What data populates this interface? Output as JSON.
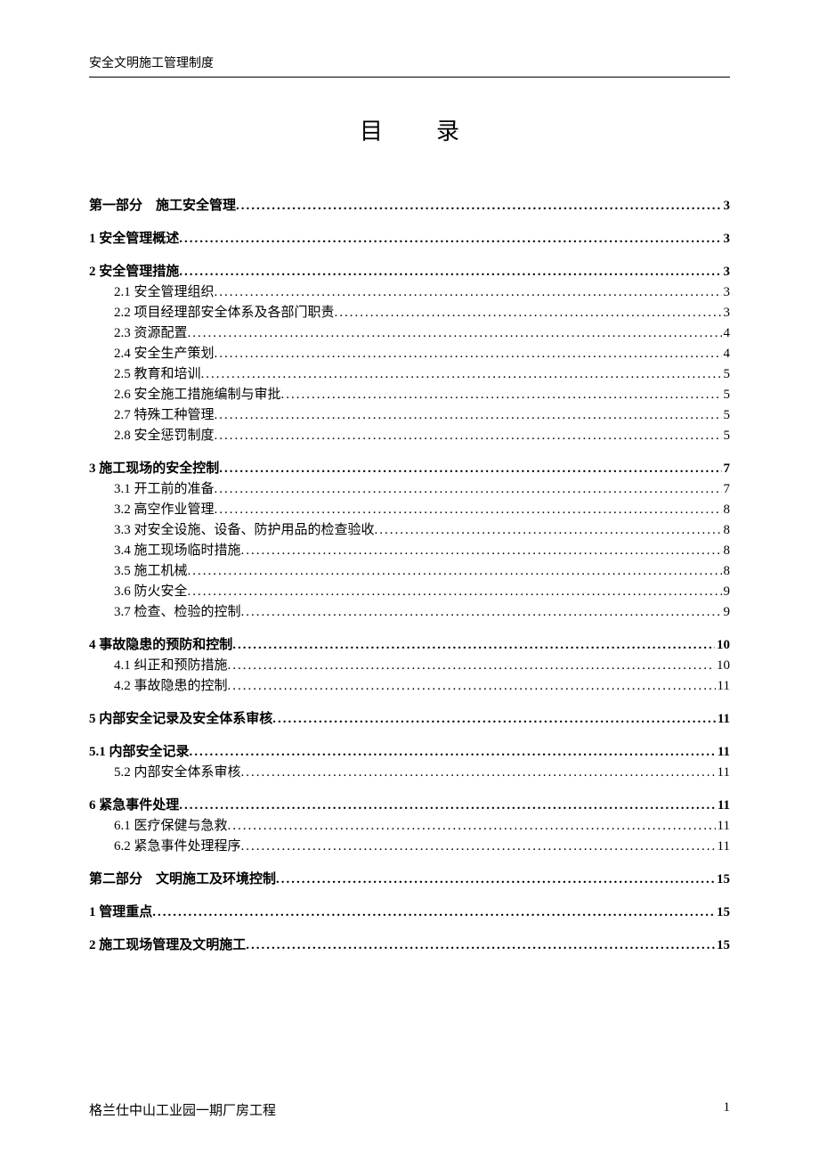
{
  "header": {
    "title": "安全文明施工管理制度"
  },
  "title": "目录",
  "toc": [
    {
      "label": "第一部分　施工安全管理",
      "page": "3",
      "level": 0,
      "gap": false
    },
    {
      "label": "1 安全管理概述",
      "page": "3",
      "level": 0,
      "gap": true
    },
    {
      "label": "2 安全管理措施",
      "page": "3",
      "level": 0,
      "gap": true
    },
    {
      "label": "2.1 安全管理组织",
      "page": "3",
      "level": 1,
      "gap": false
    },
    {
      "label": "2.2 项目经理部安全体系及各部门职责",
      "page": "3",
      "level": 1,
      "gap": false
    },
    {
      "label": "2.3 资源配置",
      "page": "4",
      "level": 1,
      "gap": false
    },
    {
      "label": "2.4 安全生产策划",
      "page": "4",
      "level": 1,
      "gap": false
    },
    {
      "label": "2.5 教育和培训",
      "page": "5",
      "level": 1,
      "gap": false
    },
    {
      "label": "2.6 安全施工措施编制与审批",
      "page": "5",
      "level": 1,
      "gap": false
    },
    {
      "label": "2.7 特殊工种管理",
      "page": "5",
      "level": 1,
      "gap": false
    },
    {
      "label": "2.8 安全惩罚制度",
      "page": "5",
      "level": 1,
      "gap": false
    },
    {
      "label": "3 施工现场的安全控制",
      "page": "7",
      "level": 0,
      "gap": true
    },
    {
      "label": "3.1 开工前的准备",
      "page": "7",
      "level": 1,
      "gap": false
    },
    {
      "label": "3.2 高空作业管理",
      "page": "8",
      "level": 1,
      "gap": false
    },
    {
      "label": "3.3 对安全设施、设备、防护用品的检查验收",
      "page": "8",
      "level": 1,
      "gap": false
    },
    {
      "label": "3.4 施工现场临时措施",
      "page": "8",
      "level": 1,
      "gap": false
    },
    {
      "label": "3.5 施工机械",
      "page": "8",
      "level": 1,
      "gap": false
    },
    {
      "label": "3.6 防火安全",
      "page": "9",
      "level": 1,
      "gap": false
    },
    {
      "label": "3.7 检查、检验的控制",
      "page": "9",
      "level": 1,
      "gap": false
    },
    {
      "label": "4 事故隐患的预防和控制",
      "page": "10",
      "level": 0,
      "gap": true
    },
    {
      "label": "4.1 纠正和预防措施",
      "page": "10",
      "level": 1,
      "gap": false
    },
    {
      "label": "4.2 事故隐患的控制",
      "page": "11",
      "level": 1,
      "gap": false
    },
    {
      "label": "5 内部安全记录及安全体系审核",
      "page": "11",
      "level": 0,
      "gap": true
    },
    {
      "label": "5.1 内部安全记录",
      "page": "11",
      "level": 0,
      "gap": true
    },
    {
      "label": "5.2 内部安全体系审核",
      "page": "11",
      "level": 1,
      "gap": false
    },
    {
      "label": "6 紧急事件处理",
      "page": "11",
      "level": 0,
      "gap": true
    },
    {
      "label": "6.1 医疗保健与急救",
      "page": "11",
      "level": 1,
      "gap": false
    },
    {
      "label": "6.2 紧急事件处理程序",
      "page": "11",
      "level": 1,
      "gap": false
    },
    {
      "label": "第二部分　文明施工及环境控制",
      "page": "15",
      "level": 0,
      "gap": true
    },
    {
      "label": "1 管理重点",
      "page": "15",
      "level": 0,
      "gap": true
    },
    {
      "label": "2 施工现场管理及文明施工",
      "page": "15",
      "level": 0,
      "gap": true
    }
  ],
  "footer": {
    "project": "格兰仕中山工业园一期厂房工程",
    "page_number": "1"
  }
}
